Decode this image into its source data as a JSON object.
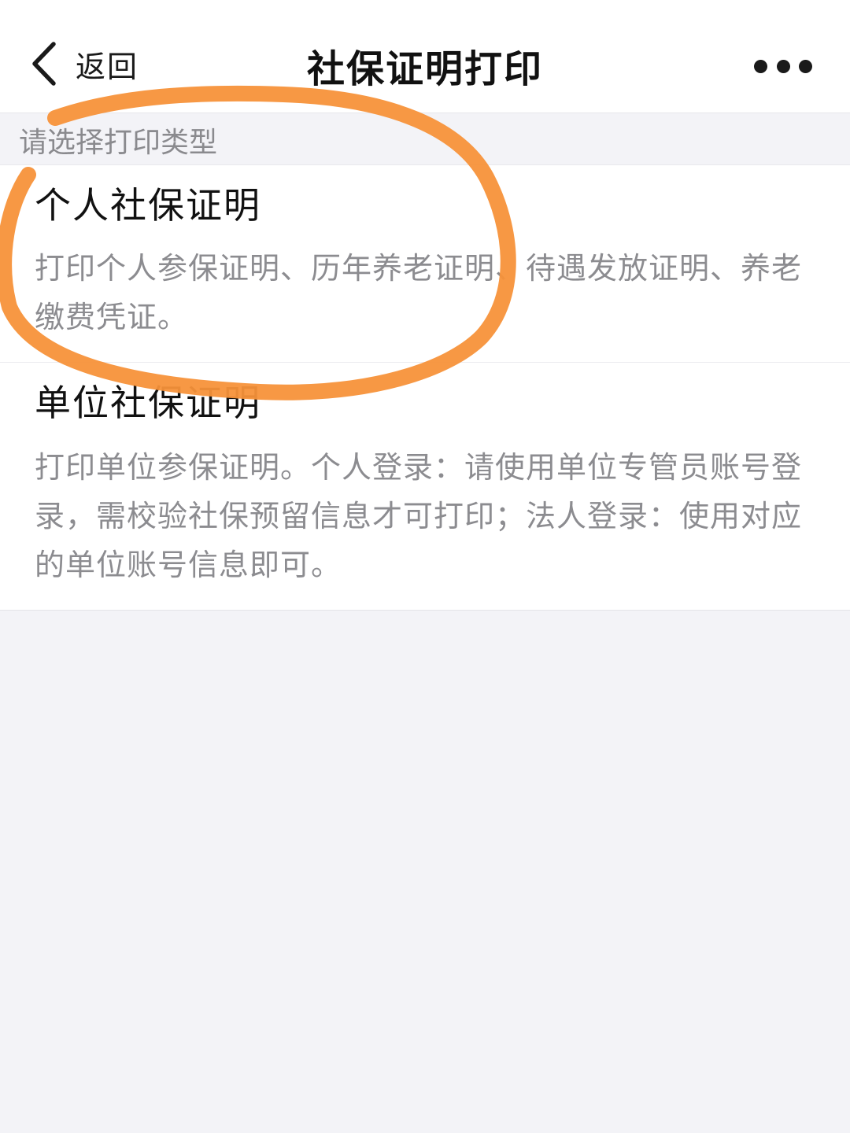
{
  "navbar": {
    "back_label": "返回",
    "title": "社保证明打印",
    "more_icon": "more-horizontal-icon",
    "back_icon": "chevron-left-icon"
  },
  "section": {
    "label": "请选择打印类型"
  },
  "print_types": [
    {
      "title": "个人社保证明",
      "description": "打印个人参保证明、历年养老证明、待遇发放证明、养老缴费凭证。"
    },
    {
      "title": "单位社保证明",
      "description": "打印单位参保证明。个人登录：请使用单位专管员账号登录，需校验社保预留信息才可打印；法人登录：使用对应的单位账号信息即可。"
    }
  ],
  "annotation": {
    "color": "#f7923a"
  }
}
